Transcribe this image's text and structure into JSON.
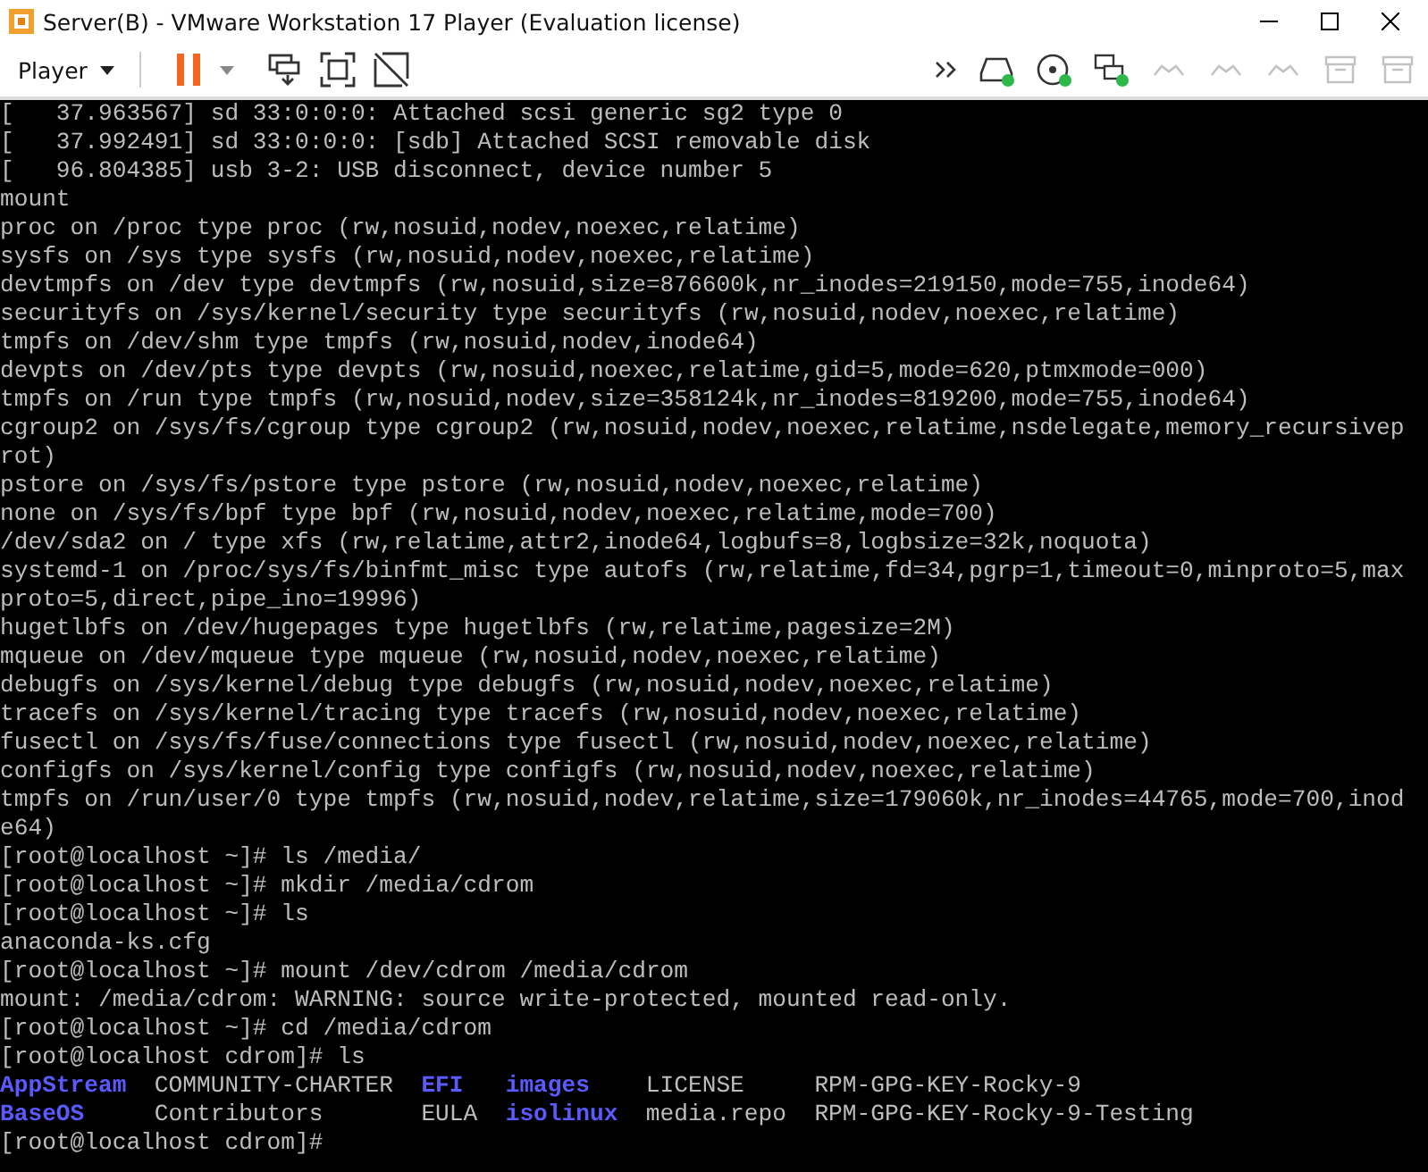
{
  "window": {
    "title": "Server(B) - VMware Workstation 17 Player (Evaluation license)"
  },
  "toolbar": {
    "menu": "Player",
    "paused": true,
    "devices": [
      {
        "kind": "drive",
        "connected": true,
        "disabled": false
      },
      {
        "kind": "disc",
        "connected": true,
        "disabled": false
      },
      {
        "kind": "network",
        "connected": true,
        "disabled": false
      },
      {
        "kind": "connector",
        "connected": false,
        "disabled": true
      },
      {
        "kind": "connector",
        "connected": false,
        "disabled": true
      },
      {
        "kind": "connector",
        "connected": false,
        "disabled": true
      },
      {
        "kind": "tray",
        "connected": false,
        "disabled": true
      },
      {
        "kind": "tray",
        "connected": false,
        "disabled": true
      }
    ]
  },
  "terminal": {
    "lines": [
      {
        "kind": "text",
        "text": "[   37.963567] sd 33:0:0:0: Attached scsi generic sg2 type 0"
      },
      {
        "kind": "text",
        "text": "[   37.992491] sd 33:0:0:0: [sdb] Attached SCSI removable disk"
      },
      {
        "kind": "text",
        "text": "[   96.804385] usb 3-2: USB disconnect, device number 5"
      },
      {
        "kind": "text",
        "text": "mount"
      },
      {
        "kind": "text",
        "text": "proc on /proc type proc (rw,nosuid,nodev,noexec,relatime)"
      },
      {
        "kind": "text",
        "text": "sysfs on /sys type sysfs (rw,nosuid,nodev,noexec,relatime)"
      },
      {
        "kind": "text",
        "text": "devtmpfs on /dev type devtmpfs (rw,nosuid,size=876600k,nr_inodes=219150,mode=755,inode64)"
      },
      {
        "kind": "text",
        "text": "securityfs on /sys/kernel/security type securityfs (rw,nosuid,nodev,noexec,relatime)"
      },
      {
        "kind": "text",
        "text": "tmpfs on /dev/shm type tmpfs (rw,nosuid,nodev,inode64)"
      },
      {
        "kind": "text",
        "text": "devpts on /dev/pts type devpts (rw,nosuid,noexec,relatime,gid=5,mode=620,ptmxmode=000)"
      },
      {
        "kind": "text",
        "text": "tmpfs on /run type tmpfs (rw,nosuid,nodev,size=358124k,nr_inodes=819200,mode=755,inode64)"
      },
      {
        "kind": "text",
        "text": "cgroup2 on /sys/fs/cgroup type cgroup2 (rw,nosuid,nodev,noexec,relatime,nsdelegate,memory_recursivep"
      },
      {
        "kind": "text",
        "text": "rot)"
      },
      {
        "kind": "text",
        "text": "pstore on /sys/fs/pstore type pstore (rw,nosuid,nodev,noexec,relatime)"
      },
      {
        "kind": "text",
        "text": "none on /sys/fs/bpf type bpf (rw,nosuid,nodev,noexec,relatime,mode=700)"
      },
      {
        "kind": "text",
        "text": "/dev/sda2 on / type xfs (rw,relatime,attr2,inode64,logbufs=8,logbsize=32k,noquota)"
      },
      {
        "kind": "text",
        "text": "systemd-1 on /proc/sys/fs/binfmt_misc type autofs (rw,relatime,fd=34,pgrp=1,timeout=0,minproto=5,max"
      },
      {
        "kind": "text",
        "text": "proto=5,direct,pipe_ino=19996)"
      },
      {
        "kind": "text",
        "text": "hugetlbfs on /dev/hugepages type hugetlbfs (rw,relatime,pagesize=2M)"
      },
      {
        "kind": "text",
        "text": "mqueue on /dev/mqueue type mqueue (rw,nosuid,nodev,noexec,relatime)"
      },
      {
        "kind": "text",
        "text": "debugfs on /sys/kernel/debug type debugfs (rw,nosuid,nodev,noexec,relatime)"
      },
      {
        "kind": "text",
        "text": "tracefs on /sys/kernel/tracing type tracefs (rw,nosuid,nodev,noexec,relatime)"
      },
      {
        "kind": "text",
        "text": "fusectl on /sys/fs/fuse/connections type fusectl (rw,nosuid,nodev,noexec,relatime)"
      },
      {
        "kind": "text",
        "text": "configfs on /sys/kernel/config type configfs (rw,nosuid,nodev,noexec,relatime)"
      },
      {
        "kind": "text",
        "text": "tmpfs on /run/user/0 type tmpfs (rw,nosuid,nodev,relatime,size=179060k,nr_inodes=44765,mode=700,inod"
      },
      {
        "kind": "text",
        "text": "e64)"
      },
      {
        "kind": "text",
        "text": "[root@localhost ~]# ls /media/"
      },
      {
        "kind": "text",
        "text": "[root@localhost ~]# mkdir /media/cdrom"
      },
      {
        "kind": "text",
        "text": "[root@localhost ~]# ls"
      },
      {
        "kind": "text",
        "text": "anaconda-ks.cfg"
      },
      {
        "kind": "text",
        "text": "[root@localhost ~]# mount /dev/cdrom /media/cdrom"
      },
      {
        "kind": "text",
        "text": "mount: /media/cdrom: WARNING: source write-protected, mounted read-only."
      },
      {
        "kind": "text",
        "text": "[root@localhost ~]# cd /media/cdrom"
      },
      {
        "kind": "text",
        "text": "[root@localhost cdrom]# ls"
      },
      {
        "kind": "listing",
        "entries": [
          {
            "name": "AppStream",
            "kind": "dir"
          },
          {
            "name": "COMMUNITY-CHARTER",
            "kind": "file"
          },
          {
            "name": "EFI",
            "kind": "dir"
          },
          {
            "name": "images",
            "kind": "dir"
          },
          {
            "name": "LICENSE",
            "kind": "file"
          },
          {
            "name": "RPM-GPG-KEY-Rocky-9",
            "kind": "file"
          }
        ]
      },
      {
        "kind": "listing",
        "entries": [
          {
            "name": "BaseOS",
            "kind": "dir"
          },
          {
            "name": "Contributors",
            "kind": "file"
          },
          {
            "name": "EULA",
            "kind": "file"
          },
          {
            "name": "isolinux",
            "kind": "dir"
          },
          {
            "name": "media.repo",
            "kind": "file"
          },
          {
            "name": "RPM-GPG-KEY-Rocky-9-Testing",
            "kind": "file"
          }
        ]
      },
      {
        "kind": "text",
        "text": "[root@localhost cdrom]#"
      }
    ]
  }
}
